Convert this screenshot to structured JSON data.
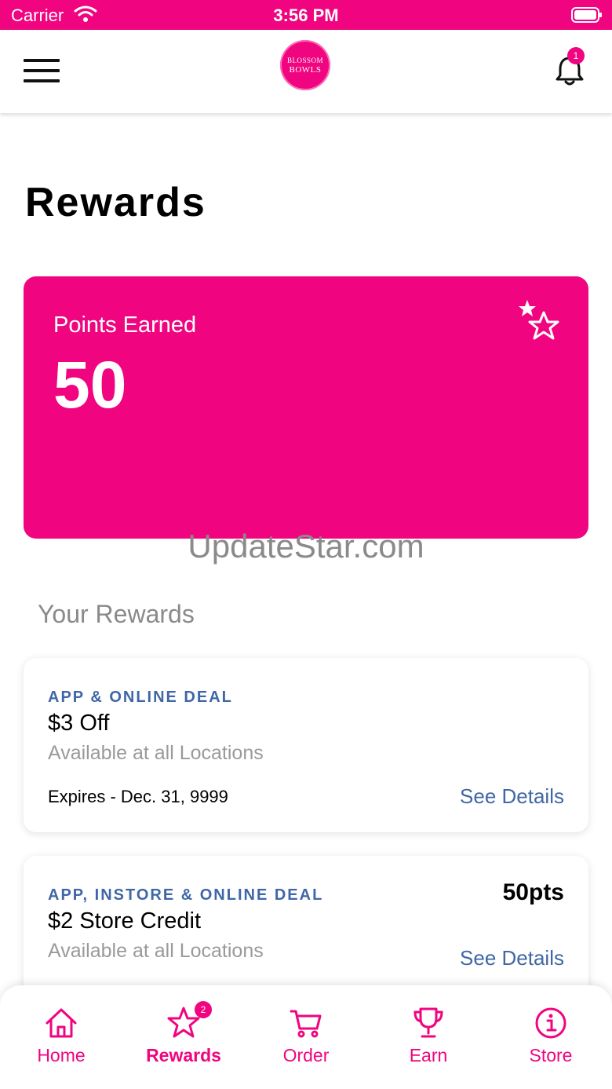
{
  "status_bar": {
    "carrier": "Carrier",
    "time": "3:56 PM"
  },
  "header": {
    "logo_line1": "BLOSSOM",
    "logo_line2": "BOWLS",
    "notification_count": "1"
  },
  "page": {
    "title": "Rewards"
  },
  "points_card": {
    "label": "Points Earned",
    "value": "50"
  },
  "watermark": "UpdateStar.com",
  "rewards_section": {
    "title": "Your Rewards",
    "items": [
      {
        "deal_type": "APP & ONLINE DEAL",
        "title": "$3 Off",
        "subtitle": "Available at all Locations",
        "expires": "Expires - Dec. 31, 9999",
        "details_label": "See Details"
      },
      {
        "deal_type": "APP, INSTORE & ONLINE DEAL",
        "title": "$2 Store Credit",
        "subtitle": "Available at all Locations",
        "points": "50pts",
        "details_label": "See Details"
      }
    ]
  },
  "tab_bar": {
    "tabs": [
      {
        "label": "Home",
        "icon": "home-icon"
      },
      {
        "label": "Rewards",
        "icon": "star-icon",
        "badge": "2",
        "active": true
      },
      {
        "label": "Order",
        "icon": "cart-icon"
      },
      {
        "label": "Earn",
        "icon": "trophy-icon"
      },
      {
        "label": "Store",
        "icon": "info-icon"
      }
    ]
  },
  "colors": {
    "brand": "#f0047f",
    "link": "#3f67a6",
    "muted": "#9a9a9a"
  }
}
